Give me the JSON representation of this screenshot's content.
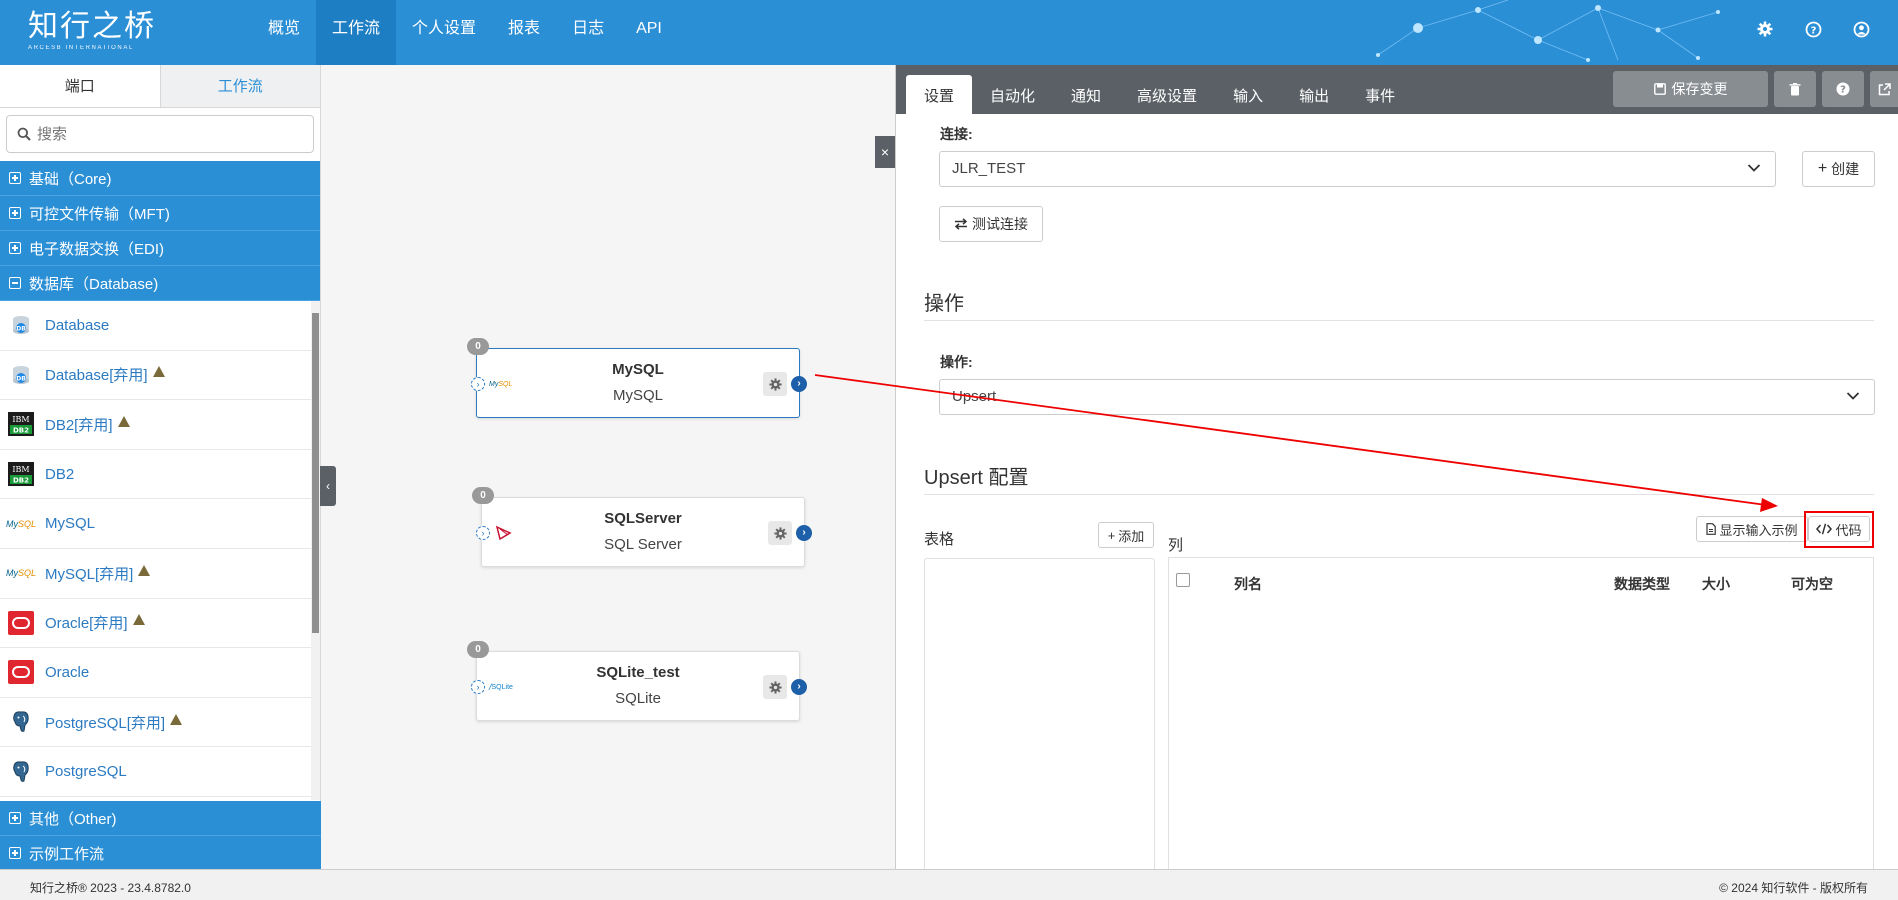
{
  "header": {
    "logo_main": "知行之桥",
    "logo_sub": "ARCESB INTERNATIONAL",
    "nav": [
      "概览",
      "工作流",
      "个人设置",
      "报表",
      "日志",
      "API"
    ],
    "nav_active": 1
  },
  "left": {
    "tabs": [
      "端口",
      "工作流"
    ],
    "search_placeholder": "搜索",
    "categories_top": [
      "基础（Core)",
      "可控文件传输（MFT)",
      "电子数据交换（EDI)",
      "数据库（Database)"
    ],
    "items": [
      {
        "label": "Database",
        "icon": "database-icon",
        "warn": false
      },
      {
        "label": "Database[弃用]",
        "icon": "database-icon",
        "warn": true
      },
      {
        "label": "DB2[弃用]",
        "icon": "ibm-db2-icon",
        "warn": true
      },
      {
        "label": "DB2",
        "icon": "ibm-db2-icon",
        "warn": false
      },
      {
        "label": "MySQL",
        "icon": "mysql-icon",
        "warn": false
      },
      {
        "label": "MySQL[弃用]",
        "icon": "mysql-icon",
        "warn": true
      },
      {
        "label": "Oracle[弃用]",
        "icon": "oracle-icon",
        "warn": true
      },
      {
        "label": "Oracle",
        "icon": "oracle-icon",
        "warn": false
      },
      {
        "label": "PostgreSQL[弃用]",
        "icon": "postgresql-icon",
        "warn": true
      },
      {
        "label": "PostgreSQL",
        "icon": "postgresql-icon",
        "warn": false
      }
    ],
    "categories_bottom": [
      "其他（Other)",
      "示例工作流"
    ]
  },
  "canvas": {
    "nodes": [
      {
        "title": "MySQL",
        "sub": "MySQL",
        "badge": "0",
        "logo": "mysql-icon"
      },
      {
        "title": "SQLServer",
        "sub": "SQL Server",
        "badge": "0",
        "logo": "sqlserver-icon"
      },
      {
        "title": "SQLite_test",
        "sub": "SQLite",
        "badge": "0",
        "logo": "sqlite-icon"
      }
    ]
  },
  "right": {
    "tabs": [
      "设置",
      "自动化",
      "通知",
      "高级设置",
      "输入",
      "输出",
      "事件"
    ],
    "save_label": "保存变更",
    "connection_label": "连接:",
    "connection_value": "JLR_TEST",
    "create_label": "创建",
    "test_label": "测试连接",
    "operation_heading": "操作",
    "operation_label": "操作:",
    "operation_value": "Upsert",
    "upsert_heading": "Upsert 配置",
    "table_label": "表格",
    "add_label": "添加",
    "column_label": "列",
    "show_sample_label": "显示输入示例",
    "code_label": "代码",
    "col_headers": [
      "列名",
      "数据类型",
      "大小",
      "可为空"
    ]
  },
  "footer": {
    "left": "知行之桥® 2023 - 23.4.8782.0",
    "right": "© 2024 知行软件 - 版权所有"
  },
  "colors": {
    "brand": "#2b8fd6",
    "tabbar": "#5a6066",
    "highlight": "#e00000"
  }
}
